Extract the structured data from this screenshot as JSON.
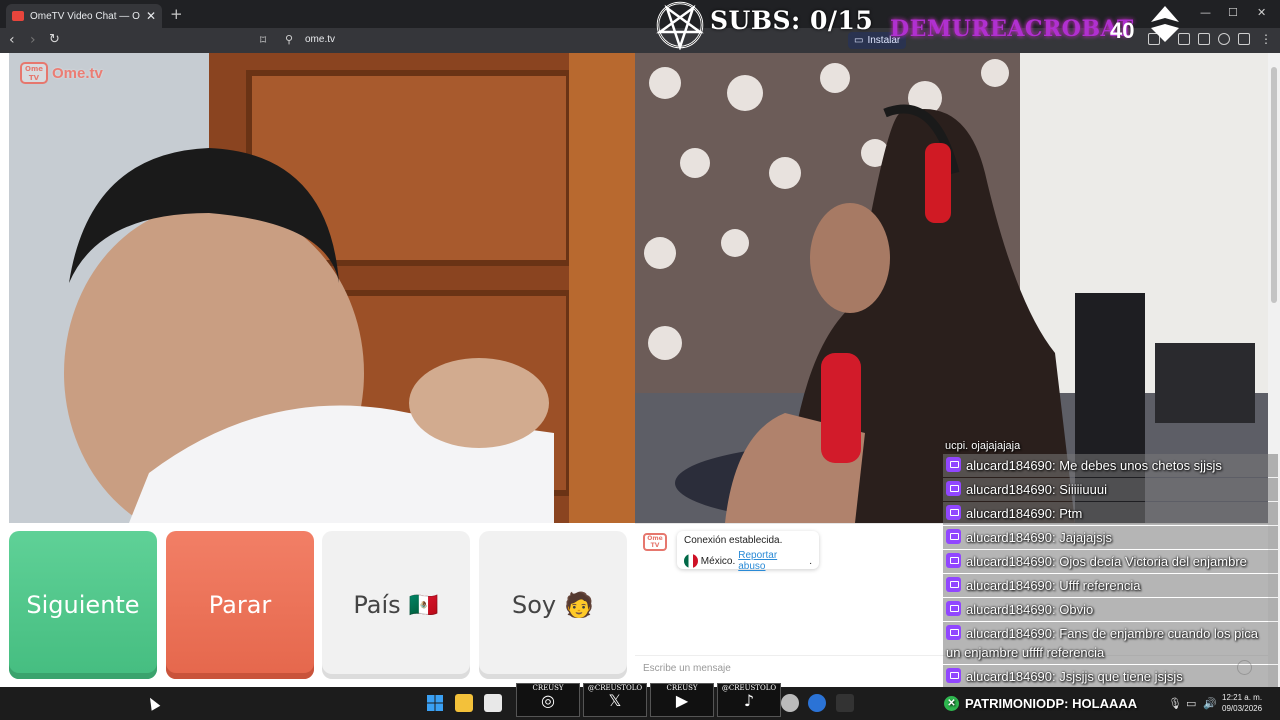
{
  "browser": {
    "tab_title": "OmeTV Video Chat — Omegle",
    "tab_close": "✕",
    "new_tab": "+",
    "url": "ome.tv",
    "install_label": "Instalar",
    "minimize": "—",
    "maximize": "☐",
    "close": "✕"
  },
  "overlay": {
    "subs_text": "SUBS: 0/15",
    "name_text": "DEMUREACROBAT",
    "count_text": "40"
  },
  "brand": {
    "icon_text": "Ome TV",
    "text": "Ome.tv"
  },
  "buttons": {
    "next": "Siguiente",
    "stop": "Parar",
    "country": "País",
    "country_flag": "🇲🇽",
    "iam": "Soy",
    "iam_emoji": "🧑"
  },
  "chat": {
    "icon_text": "Ome TV",
    "connection": "Conexión establecida.",
    "country": "México.",
    "report": "Reportar abuso",
    "report_suffix": ".",
    "placeholder": "Escribe un mensaje"
  },
  "twitch_chat": {
    "cut_line": "ucpi. ojajajajaja",
    "messages": [
      {
        "user": "alucard184690",
        "text": "Me debes unos chetos sjjsjs"
      },
      {
        "user": "alucard184690",
        "text": "Siiiiiuuui"
      },
      {
        "user": "alucard184690",
        "text": "Ptm"
      },
      {
        "user": "alucard184690",
        "text": "Jajajajsjs"
      },
      {
        "user": "alucard184690",
        "text": "Ojos decía Victoria del enjambre"
      },
      {
        "user": "alucard184690",
        "text": "Ufff referencia"
      },
      {
        "user": "alucard184690",
        "text": "Obvio"
      },
      {
        "user": "alucard184690",
        "text": "Fans de enjambre cuando los pica un enjambre uffff referencia"
      },
      {
        "user": "alucard184690",
        "text": "Jsjsjjs que tiene jsjsjs"
      }
    ]
  },
  "taskbar": {
    "socials": [
      {
        "handle": "CREUSY",
        "icon": "instagram-icon",
        "glyph": "◎"
      },
      {
        "handle": "@CREUSTOLO",
        "icon": "x-icon",
        "glyph": "𝕏"
      },
      {
        "handle": "CREUSY",
        "icon": "youtube-icon",
        "glyph": "▶"
      },
      {
        "handle": "@CREUSTOLO",
        "icon": "tiktok-icon",
        "glyph": "♪"
      }
    ],
    "patron": "PATRIMONIODP: HOLAAAA",
    "time": "12:21 a. m.",
    "date": "09/03/2026"
  },
  "colors": {
    "next": "#4fc98a",
    "stop": "#ea6f55",
    "twitch": "#9146ff",
    "brand": "#eb7d74"
  }
}
